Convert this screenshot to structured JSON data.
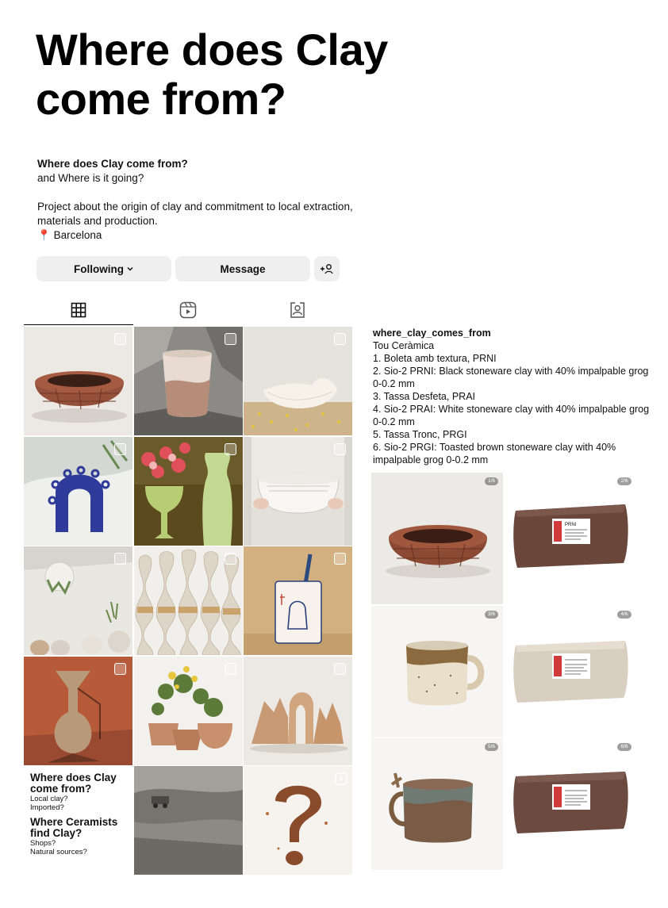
{
  "title": "Where does Clay come from?",
  "profile": {
    "bio_name": "Where does Clay come from?",
    "bio_line2": "and Where is it going?",
    "bio_desc": "Project about the origin of clay and commitment to local extraction, materials and production.",
    "location_pin": "📍",
    "location": "Barcelona"
  },
  "actions": {
    "following_label": "Following",
    "following_chevron": "⌄",
    "message_label": "Message",
    "add_user_icon": "add-user-icon"
  },
  "tabs": [
    {
      "icon": "grid-icon",
      "active": true
    },
    {
      "icon": "reels-icon",
      "active": false
    },
    {
      "icon": "tagged-icon",
      "active": false
    }
  ],
  "grid_text_tile": {
    "h1": "Where does Clay come from?",
    "s1a": "Local clay?",
    "s1b": "Imported?",
    "h2": "Where Ceramists find Clay?",
    "s2a": "Shops?",
    "s2b": "Natural sources?"
  },
  "caption": {
    "handle": "where_clay_comes_from",
    "brand": "Tou Ceràmica",
    "lines": [
      "1. Boleta amb textura, PRNI",
      "2. Sio-2 PRNI: Black stoneware clay with 40% impalpable grog 0-0.2 mm",
      "3. Tassa Desfeta, PRAI",
      "4. Sio-2 PRAI: White stoneware clay with 40% impalpable grog 0-0.2 mm",
      "5. Tassa Tronc, PRGI",
      "6. Sio-2 PRGI: Toasted brown stoneware clay with 40% impalpable grog 0-0.2 mm"
    ]
  },
  "product_badges": [
    "1/6",
    "2/6",
    "3/6",
    "4/6",
    "5/6",
    "6/6"
  ],
  "product_label": "PRNI",
  "colors": {
    "button_bg": "#efefef",
    "terracotta": "#9a5a40",
    "clay_brown": "#6e4a3d"
  }
}
